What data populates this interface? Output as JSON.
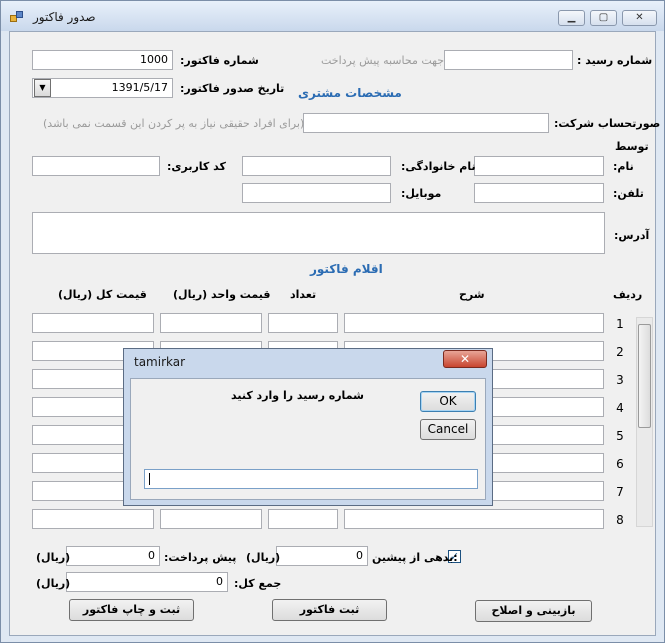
{
  "window": {
    "title": "صدور فاکتور",
    "minimize": "▁",
    "maximize": "▢",
    "close": "✕"
  },
  "header": {
    "invoice_number_label": "شماره فاکتور:",
    "invoice_number_value": "1000",
    "receipt_number_label": "شماره رسید :",
    "receipt_number_value": "",
    "prepayment_note": "جهت محاسبه پیش پرداخت",
    "issue_date_label": "تاریخ صدور فاکتور:",
    "issue_date_value": "1391/5/17"
  },
  "customer": {
    "section_title": "مشخصات مشتری",
    "company_label": "صورتحساب شرکت:",
    "company_value": "",
    "company_hint": "(برای افراد حقیقی نیاز به پر کردن این قسمت نمی باشد)",
    "by_label": "توسط",
    "first_name_label": "نام:",
    "last_name_label": "نام خانوادگی:",
    "user_code_label": "کد کاربری:",
    "phone_label": "تلفن:",
    "mobile_label": "موبایل:",
    "address_label": "آدرس:"
  },
  "items": {
    "section_title": "اقلام فاکتور",
    "columns": {
      "row": "ردیف",
      "description": "شرح",
      "quantity": "تعداد",
      "unit_price": "قیمت واحد (ریال)",
      "total_price": "قیمت کل (ریال)"
    },
    "rows": [
      "1",
      "2",
      "3",
      "4",
      "5",
      "6",
      "7",
      "8"
    ]
  },
  "totals": {
    "debt_label": ":بدهی از پیشین",
    "debt_checked": true,
    "debt_value": "0",
    "prepayment_label": "پیش پرداخت:",
    "prepayment_value": "0",
    "total_label": "جمع کل:",
    "total_value": "0",
    "currency": "(ریال)"
  },
  "buttons": {
    "save_print": "ثبت و چاپ فاکتور",
    "save": "ثبت فاکتور",
    "review": "بازبینی و اصلاح"
  },
  "dialog": {
    "title": "tamirkar",
    "close": "✕",
    "message": "شماره رسید را وارد کنید",
    "ok": "OK",
    "cancel": "Cancel",
    "input_value": ""
  },
  "colors": {
    "section_blue": "#2b6cb3",
    "hint_gray": "#9b9b9b",
    "dialog_close_red": "#c8452f"
  }
}
